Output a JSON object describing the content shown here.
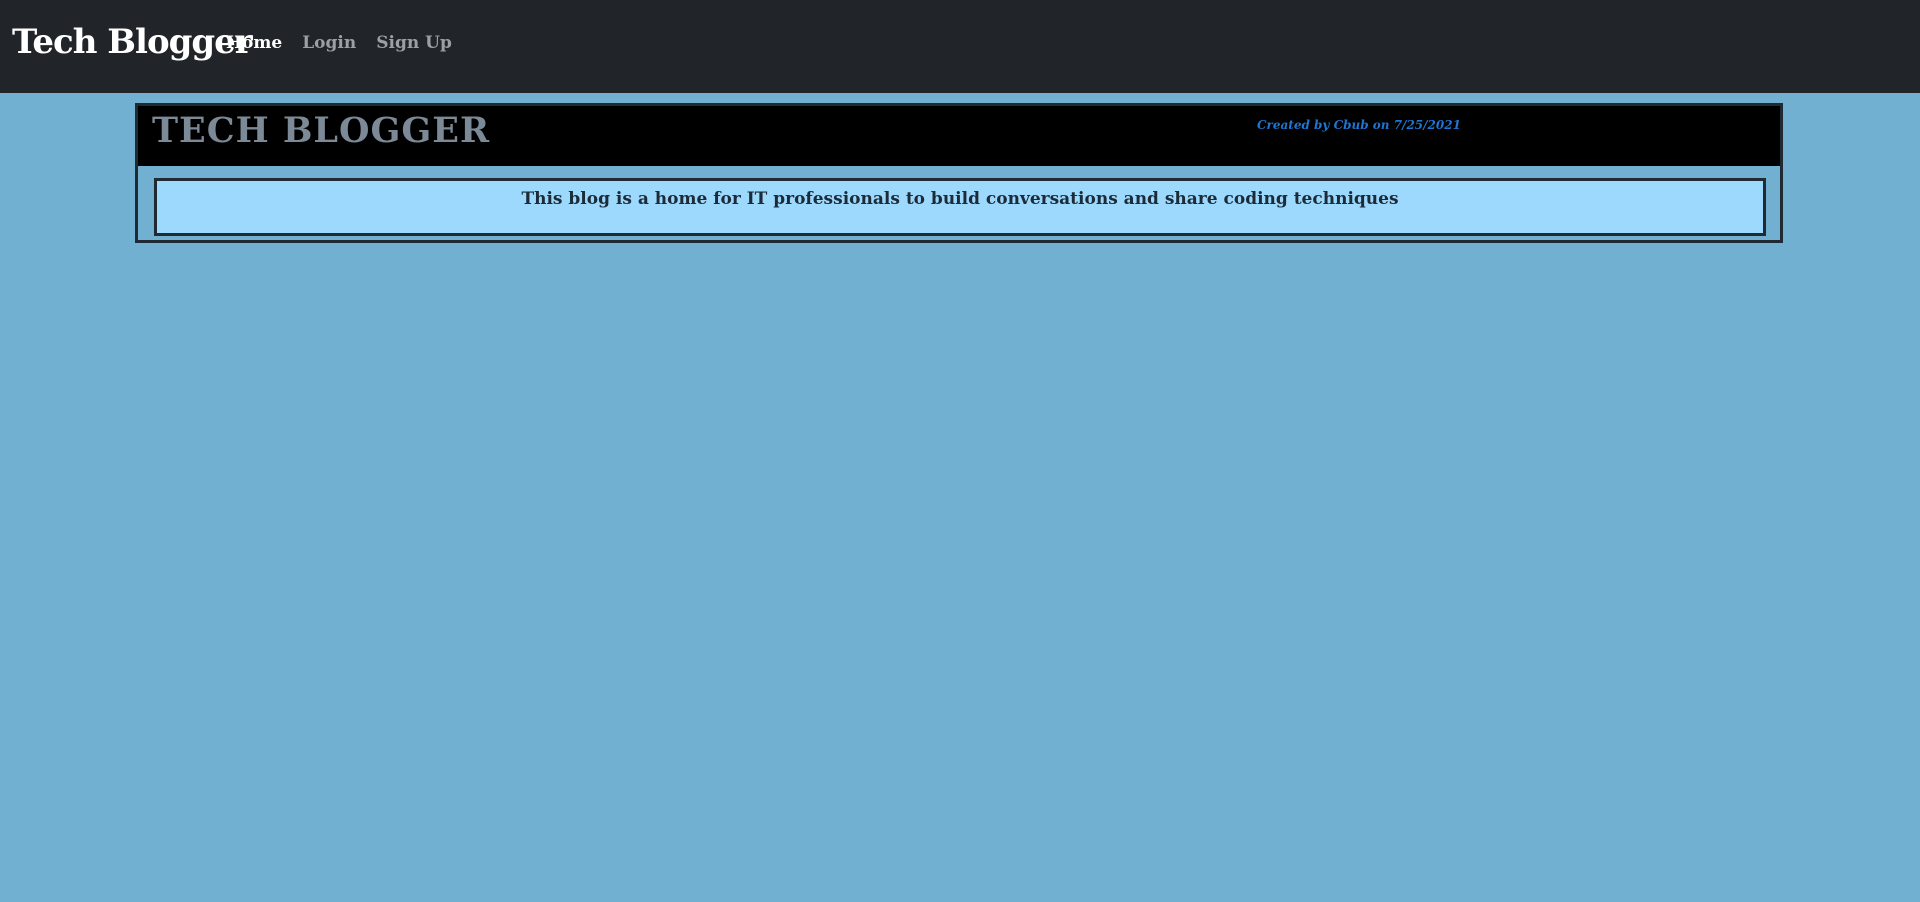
{
  "navbar": {
    "brand": "Tech Blogger",
    "links": [
      {
        "label": "Home",
        "active": true
      },
      {
        "label": "Login",
        "active": false
      },
      {
        "label": "Sign Up",
        "active": false
      }
    ]
  },
  "post": {
    "title": "TECH BLOGGER",
    "meta": "Created by Cbub on 7/25/2021",
    "body": "This blog is a home for IT professionals to build conversations and share coding techniques"
  },
  "colors": {
    "page_background": "#71b0d1",
    "navbar_background": "#212529",
    "card_header_background": "#000000",
    "card_body_background": "#9dd8fd",
    "meta_text": "#1d76d2"
  }
}
